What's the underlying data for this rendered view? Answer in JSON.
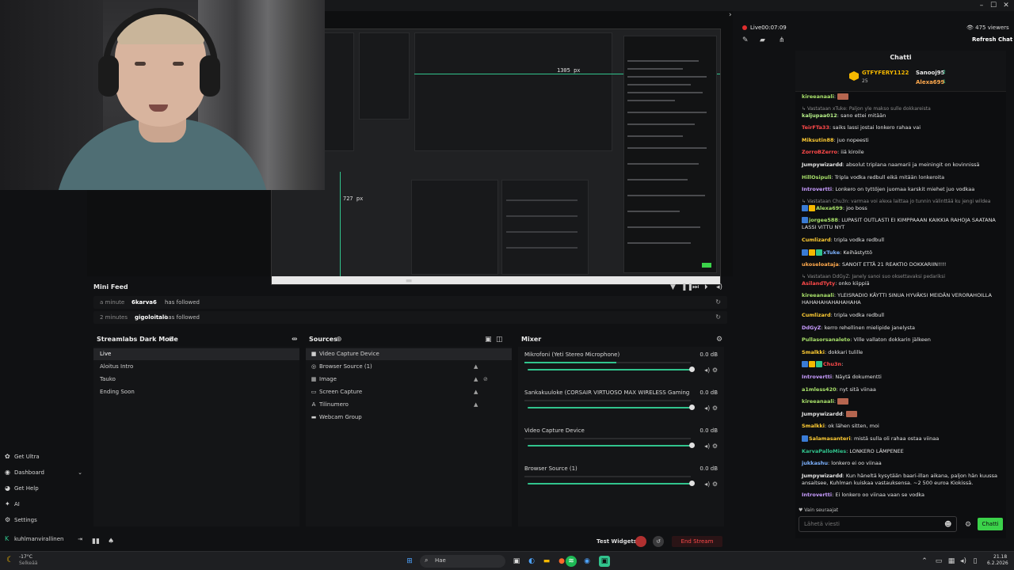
{
  "window": {
    "minimize": "–",
    "maximize": "☐",
    "close": "✕"
  },
  "stream": {
    "live_label": "Live",
    "live_time": "00:07:09",
    "viewers": "475 viewers",
    "refresh_chat": "Refresh Chat"
  },
  "preview": {
    "label_width": "1305 px",
    "label_height": "727 px"
  },
  "mini_feed": {
    "title": "Mini Feed",
    "rows": [
      {
        "time": "a minute",
        "user": "6karva6",
        "action": "has followed"
      },
      {
        "time": "2 minutes",
        "user": "gigoloitalo",
        "action": "has followed"
      }
    ]
  },
  "scenes": {
    "title": "Streamlabs Dark Mode",
    "items": [
      "Live",
      "Aloitus Intro",
      "Tauko",
      "Ending Soon"
    ]
  },
  "sources": {
    "title": "Sources",
    "items": [
      {
        "name": "Video Capture Device",
        "icon": "camera-icon"
      },
      {
        "name": "Browser Source (1)",
        "icon": "globe-icon"
      },
      {
        "name": "Image",
        "icon": "image-icon"
      },
      {
        "name": "Screen Capture",
        "icon": "monitor-icon"
      },
      {
        "name": "Tilinumero",
        "icon": "text-icon"
      },
      {
        "name": "Webcam Group",
        "icon": "folder-icon"
      }
    ]
  },
  "mixer": {
    "title": "Mixer",
    "channels": [
      {
        "name": "Mikrofoni (Yeti Stereo Microphone)",
        "db": "0.0 dB",
        "level": 0.55,
        "volume": 1.0
      },
      {
        "name": "Sankakuuloke (CORSAIR VIRTUOSO MAX WIRELESS Gaming Recei...",
        "db": "0.0 dB",
        "level": 0.0,
        "volume": 1.0
      },
      {
        "name": "Video Capture Device",
        "db": "0.0 dB",
        "level": 0.0,
        "volume": 1.0
      },
      {
        "name": "Browser Source (1)",
        "db": "0.0 dB",
        "level": 0.0,
        "volume": 1.0
      }
    ]
  },
  "nav": {
    "items": [
      {
        "label": "Get Ultra",
        "icon": "ultra-icon"
      },
      {
        "label": "Dashboard",
        "icon": "dashboard-icon"
      },
      {
        "label": "Get Help",
        "icon": "help-icon"
      },
      {
        "label": "AI",
        "icon": "ai-icon"
      },
      {
        "label": "Settings",
        "icon": "gear-icon"
      }
    ],
    "username": "kuhlmanvirallinen"
  },
  "status_bar": {
    "test_widgets": "Test Widgets",
    "end_stream": "End Stream"
  },
  "chat": {
    "title": "Chatti",
    "leaderboard": {
      "first": {
        "name": "GTFYFERY1122",
        "count": "25"
      },
      "second": {
        "name": "Sanooj95",
        "count": "2"
      },
      "third": {
        "name": "Alexa699",
        "count": "1"
      }
    },
    "messages": [
      {
        "type": "msg",
        "user": "kireeanaali",
        "color": "#a8e06a",
        "text": "",
        "emote": true
      },
      {
        "type": "reply",
        "text": "Vastataan xTuke: Paljon yle makso sulle dokkareista"
      },
      {
        "type": "msg",
        "user": "kaljupaa012",
        "color": "#b8f28a",
        "text": "sano ettei mitään"
      },
      {
        "type": "msg",
        "user": "TeirFTa33",
        "color": "#ff4a4a",
        "text": "saiks lassi jostai lonkero rahaa vai"
      },
      {
        "type": "msg",
        "user": "Miksutin88",
        "color": "#ffcc33",
        "text": "juo nopeesti"
      },
      {
        "type": "msg",
        "user": "ZorroBZerro",
        "color": "#ff4a4a",
        "text": "iiä kiroile"
      },
      {
        "type": "msg",
        "user": "Jumpywizardd",
        "color": "#e8e8e8",
        "text": "absolut triplana naamarii ja meiningit on kovinnissä"
      },
      {
        "type": "msg",
        "user": "HillOsipuli",
        "color": "#a8e06a",
        "text": "Tripla vodka redbull eikä mitään lonkeroita"
      },
      {
        "type": "msg",
        "user": "Introvertti",
        "color": "#c89cff",
        "text": "Lonkero on tyttöjen juomaa karskit miehet juo vodkaa"
      },
      {
        "type": "reply",
        "text": "Vastataan Chu3n: varmaa voi alexa laittaa jo tunnin välinttää ku jengi wildea"
      },
      {
        "type": "msg",
        "user": "Alexa699",
        "color": "#a8e06a",
        "text": "joo boss",
        "badges": 2
      },
      {
        "type": "msg",
        "user": "jorgee588",
        "color": "#a8e06a",
        "text": "LUPASIT OUTLASTI EI KIMPPAAAN KAIKKIA RAHOJA SAATANA LASSI VITTU NYT",
        "badges": 1,
        "lines": 2
      },
      {
        "type": "msg",
        "user": "Cumlizard",
        "color": "#ffcc33",
        "text": "tripla vodka redbull"
      },
      {
        "type": "msg",
        "user": "xTuke",
        "color": "#7db2ff",
        "text": "Keihästyttö",
        "badges": 3
      },
      {
        "type": "msg",
        "user": "ukoseloataja",
        "color": "#ffa94d",
        "text": "SANOIT ETTÄ 21 REAKTIO DOKKARIIN!!!!"
      },
      {
        "type": "reply",
        "text": "Vastataan DdGyZ: Janely sanoi suo oksettavaksi pedariksi"
      },
      {
        "type": "msg",
        "user": "AsilandTyty",
        "color": "#ff4a4a",
        "text": "onko kiippiä"
      },
      {
        "type": "msg",
        "user": "kireeanaali",
        "color": "#a8e06a",
        "text": "YLEISRADIO KÄYTTI SINUA HYVÄKSI MEIDÄN VERORAHOILLA HAHAHAHAHAHAHAHA",
        "lines": 2
      },
      {
        "type": "msg",
        "user": "Cumlizard",
        "color": "#ffcc33",
        "text": "tripla vodka redbull"
      },
      {
        "type": "msg",
        "user": "DdGyZ",
        "color": "#c89cff",
        "text": "kerro rehellinen mielipide janelysta"
      },
      {
        "type": "msg",
        "user": "Pullasorsanaleto",
        "color": "#a8e06a",
        "text": "Ville vallaton dokkarin jälkeen"
      },
      {
        "type": "msg",
        "user": "Smalkki",
        "color": "#ffcc33",
        "text": "dokkari tulille"
      },
      {
        "type": "msg",
        "user": "Chu3n",
        "color": "#ff4a4a",
        "text": "",
        "badges": 3
      },
      {
        "type": "msg",
        "user": "Introvertti",
        "color": "#c89cff",
        "text": "Näytä dokumentti"
      },
      {
        "type": "msg",
        "user": "a1mless420",
        "color": "#a8e06a",
        "text": "nyt sitä viinaa"
      },
      {
        "type": "msg",
        "user": "kireeanaali",
        "color": "#a8e06a",
        "text": "",
        "emote": true
      },
      {
        "type": "msg",
        "user": "Jumpywizardd",
        "color": "#e8e8e8",
        "text": "",
        "emote": true
      },
      {
        "type": "msg",
        "user": "Smalkki",
        "color": "#ffcc33",
        "text": "ok lähen sitten, moi"
      },
      {
        "type": "msg",
        "user": "Salamasanteri",
        "color": "#ffcc33",
        "text": "mistä sulla oli rahaa ostaa viinaa",
        "badges": 1
      },
      {
        "type": "msg",
        "user": "KarvaPalloMies",
        "color": "#31c48d",
        "text": "LONKERO LÄMPENEE"
      },
      {
        "type": "msg",
        "user": "jukkashu",
        "color": "#7db2ff",
        "text": "lonkero ei oo viinaa"
      },
      {
        "type": "msg",
        "user": "Jumpywizardd",
        "color": "#e8e8e8",
        "text": "Kun häneltä kysytään baari-illan aikana, paljon hän kuussa ansaitsee, Kuhlman kuiskaa vastauksensa. ~2 500 euroa Kiokissä.",
        "lines": 2
      },
      {
        "type": "msg",
        "user": "Introvertti",
        "color": "#c89cff",
        "text": "Ei lonkero oo viinaa vaan se vodka"
      }
    ],
    "followers_only": "Vain seuraajat",
    "input_placeholder": "Lähetä viesti",
    "send_button": "Chatti"
  },
  "taskbar": {
    "weather_temp": "-17°C",
    "weather_text": "Selkeää",
    "search_placeholder": "Hae",
    "time": "21.18",
    "date": "6.2.2026"
  },
  "colors": {
    "accent": "#31c48d",
    "live_red": "#e02e2e",
    "chat_send": "#3bd24a"
  }
}
